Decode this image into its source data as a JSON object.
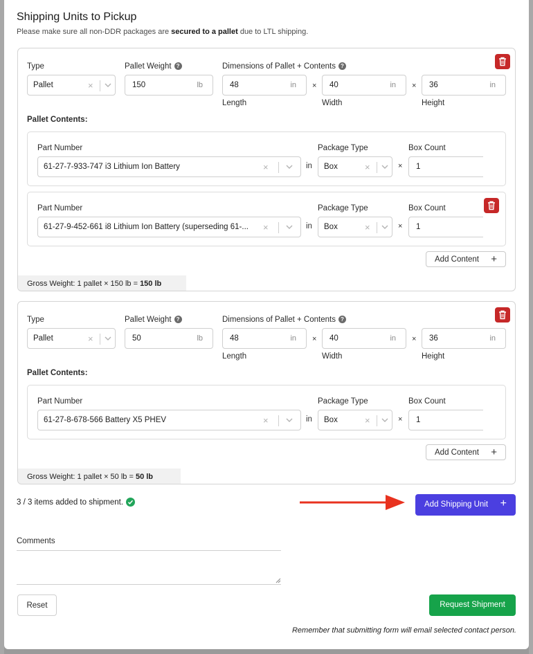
{
  "modal": {
    "title": "Shipping Units to Pickup",
    "subtitle_pre": "Please make sure all non-DDR packages are ",
    "subtitle_bold": "secured to a pallet",
    "subtitle_post": " due to LTL shipping."
  },
  "labels": {
    "type": "Type",
    "pallet_weight": "Pallet Weight",
    "dimensions": "Dimensions of Pallet + Contents",
    "length": "Length",
    "width": "Width",
    "height": "Height",
    "pallet_contents": "Pallet Contents:",
    "part_number": "Part Number",
    "package_type": "Package Type",
    "box_count": "Box Count",
    "in_word": "in",
    "times": "×",
    "add_content": "Add Content",
    "help": "?",
    "plus": "+",
    "clear": "×",
    "lb_unit": "lb",
    "in_unit": "in"
  },
  "units": [
    {
      "type": "Pallet",
      "weight": "150",
      "length": "48",
      "width": "40",
      "height": "36",
      "contents": [
        {
          "part": "61-27-7-933-747 i3 Lithium Ion Battery",
          "package": "Box",
          "count": "1"
        },
        {
          "part": "61-27-9-452-661 i8 Lithium Ion Battery (superseding 61-...",
          "package": "Box",
          "count": "1"
        }
      ],
      "gross_pre": "Gross Weight: 1 pallet  ×  150 lb  =  ",
      "gross_total": "150 lb"
    },
    {
      "type": "Pallet",
      "weight": "50",
      "length": "48",
      "width": "40",
      "height": "36",
      "contents": [
        {
          "part": "61-27-8-678-566 Battery X5 PHEV",
          "package": "Box",
          "count": "1"
        }
      ],
      "gross_pre": "Gross Weight: 1 pallet  ×  50 lb  =  ",
      "gross_total": "50 lb"
    }
  ],
  "status": {
    "added_text": "3 / 3 items added to shipment."
  },
  "actions": {
    "add_shipping_unit": "Add Shipping Unit",
    "reset": "Reset",
    "request_shipment": "Request Shipment"
  },
  "comments": {
    "label": "Comments",
    "value": ""
  },
  "note": "Remember that submitting form will email selected contact person.",
  "colors": {
    "primary": "#4b3fe0",
    "success": "#16a34a",
    "danger": "#c62828",
    "annotation_arrow": "#e8321f"
  },
  "icons": {
    "delete": "trash-icon",
    "help": "question-circle-icon",
    "add": "plus-icon",
    "clear": "close-icon",
    "dropdown": "chevron-down-icon",
    "success": "check-circle-icon",
    "annotation": "arrow-right-icon"
  }
}
